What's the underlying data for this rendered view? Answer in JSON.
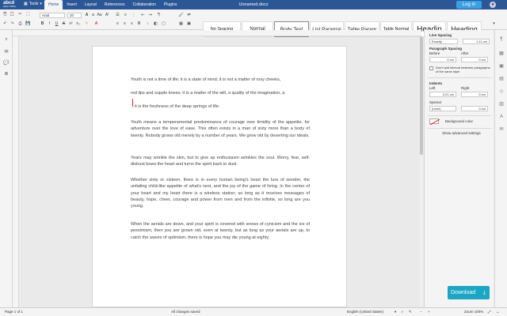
{
  "app": {
    "logo_text": "abcd",
    "logo_sub": "Open Office",
    "tools_label": "Tools",
    "tabs": [
      "Home",
      "Insert",
      "Layout",
      "References",
      "Collaboration",
      "Plugins"
    ],
    "doc_title": "Unnamed.docx",
    "login_label": "Log in"
  },
  "toolbar": {
    "font_name": "Arial",
    "font_size": "20",
    "styles": [
      "No Spacing",
      "Normal",
      "Body Text",
      "List Paragraj",
      "Table Paragr",
      "Table Normal",
      "Headin",
      "Heading"
    ]
  },
  "document": {
    "paragraphs": [
      "Youth is not a time of life; it is a state of mind; it is not a matter of rosy cheeks,",
      "red lips and supple knees; it is a matter of the will, a quality of the imagination, a",
      "it is the freshness of the deep springs of life.",
      "Youth means a temperamental predominance of courage over timidity of the appetite, for adventure over the love of ease. This often exists in a man of sixty more than a body of twenty. Nobody grows old merely by a number of years. We grow old by deserting our ideals.",
      "Years may wrinkle the skin, but to give up enthusiasm wrinkles the soul. Worry, fear, self-distrust bows the heart and turns the spirit back to dust.",
      "Whether sixty or sixteen, there is in every human being's heart the lure of wonder, the unfailing child-like appetite of what's next, and the joy of the game of living. In the center of your heart and my heart there is a wireless station; so long as it receives messages of beauty, hope, cheer, courage and power from men and from the infinite, so long are you young.",
      "When the aerials are down, and your spirit is covered with snows of cynicism and the ice of pessimism, then you are grown old, even at twenty, but as long as your aerials are up, to catch the waves of optimism, there is hope you may die young at eighty."
    ]
  },
  "right_panel": {
    "line_spacing_label": "Line Spacing",
    "line_spacing_mode": "Exactly",
    "line_spacing_value": "1.11 cm",
    "paragraph_spacing_label": "Paragraph Spacing",
    "before_label": "Before",
    "after_label": "After",
    "before_value": "0 cm",
    "after_value": "0 cm",
    "no_interval_label": "Don't add interval between paragraphs of the same style",
    "indents_label": "Indents",
    "left_label": "Left",
    "right_label": "Right",
    "left_value": "0.21 cm",
    "right_value": "0 cm",
    "special_label": "Special",
    "special_value": "(none)",
    "special_amount": "0 cm",
    "background_color_label": "Background color",
    "show_advanced_label": "Show advanced settings"
  },
  "download": {
    "label": "Download"
  },
  "status": {
    "page_info": "Page 1 of 1",
    "save_status": "All changes saved",
    "language": "English (United States)",
    "zoom": "Zoom 100%"
  },
  "colors": {
    "topbar": "#2b5797",
    "download": "#1aa6c4",
    "cursor": "#e02020"
  }
}
